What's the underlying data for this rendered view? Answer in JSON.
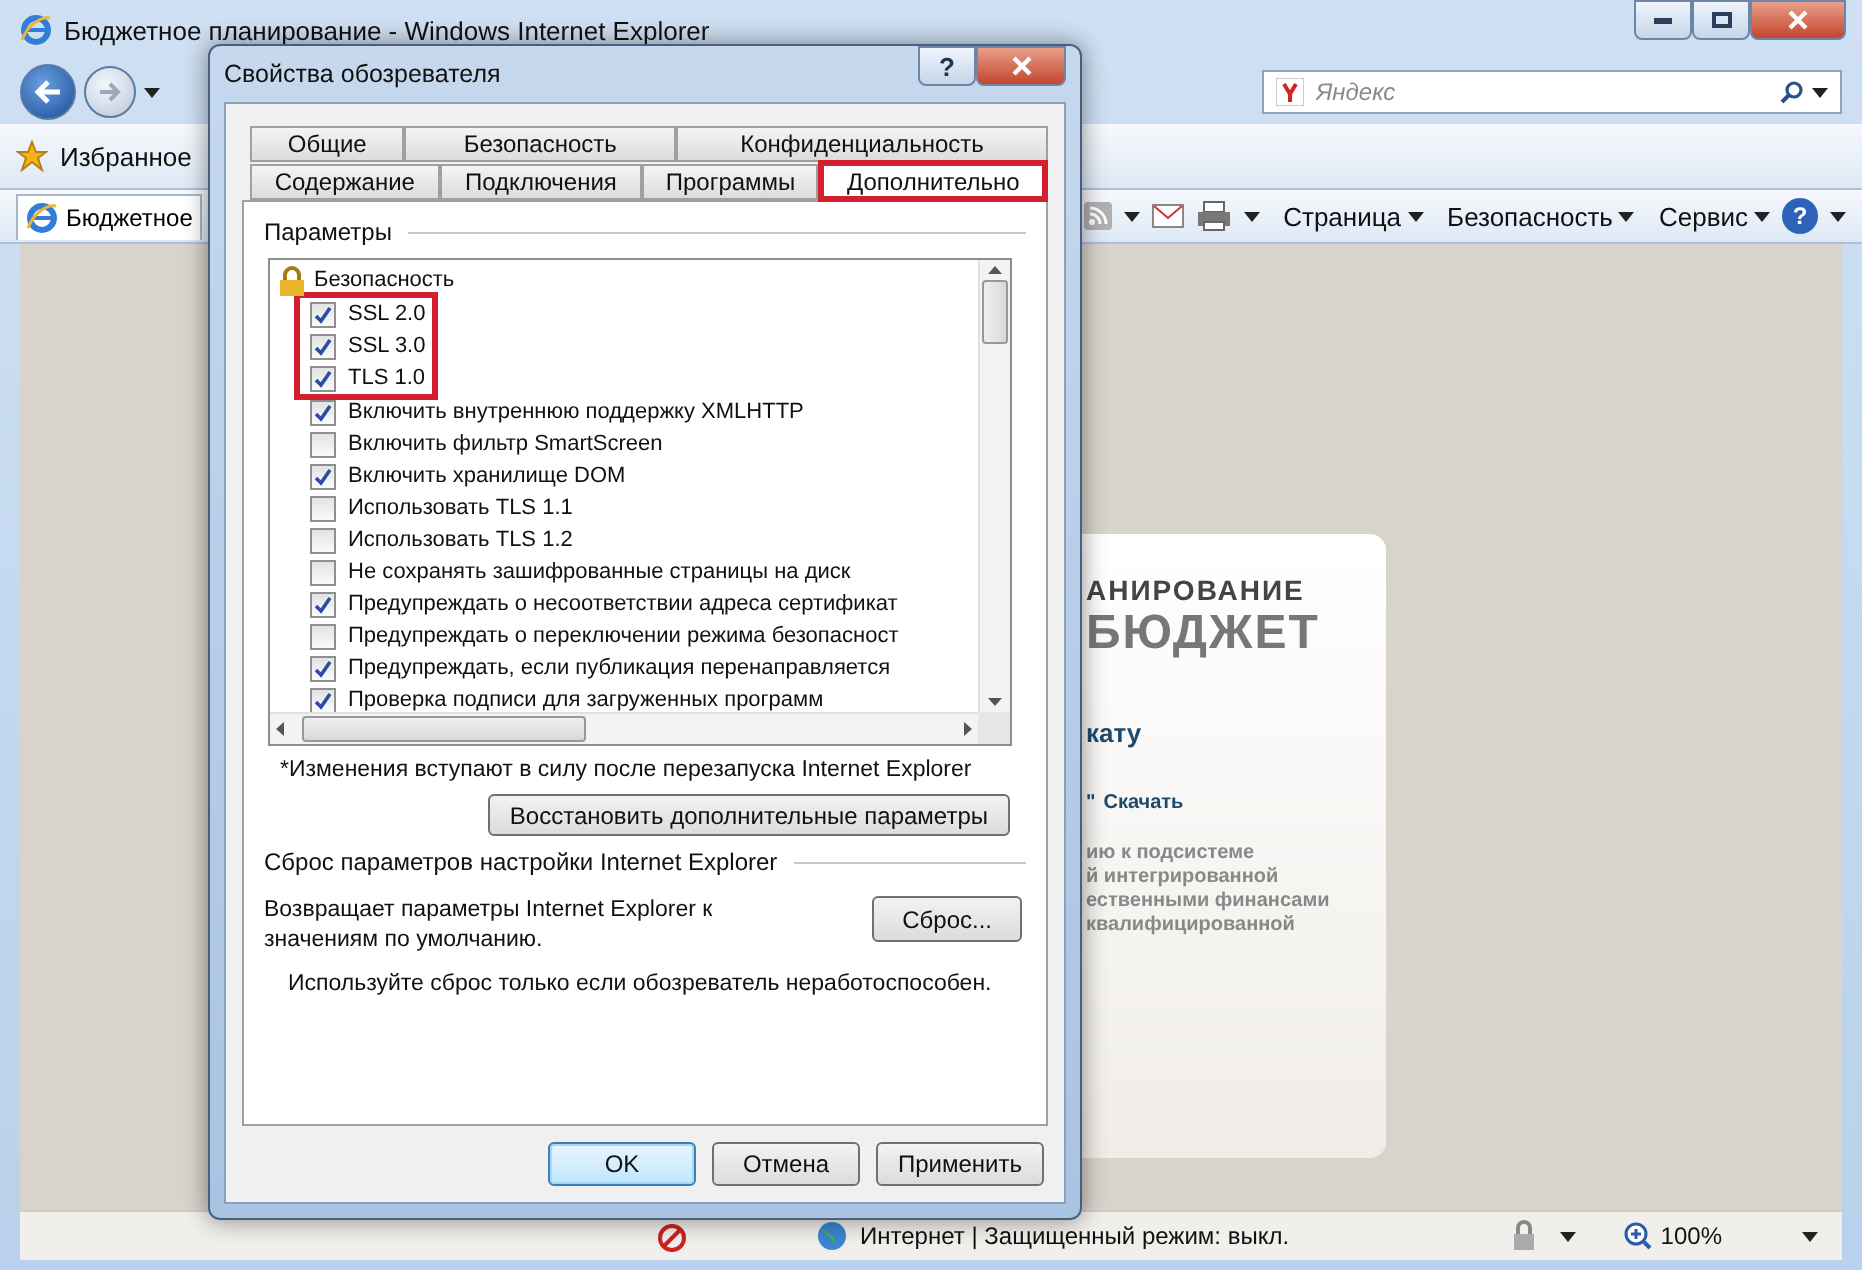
{
  "browser": {
    "title": "Бюджетное планирование - Windows Internet Explorer",
    "search": {
      "placeholder": "Яндекс"
    },
    "favorites": {
      "label": "Избранное"
    },
    "tab": {
      "label": "Бюджетное"
    },
    "commands": [
      "Страница",
      "Безопасность",
      "Сервис"
    ],
    "help_glyph": "?",
    "page": {
      "heading": "АНИРОВАНИЕ",
      "logo": "БЮДЖЕТ",
      "subheading": "кату",
      "download_prefix": "\"",
      "download_link": "Скачать",
      "description": [
        "ию к подсистеме",
        "й интегрированной",
        "ественными финансами",
        "квалифицированной"
      ]
    },
    "status_bar": {
      "zone": "Интернет | Защищенный режим: выкл.",
      "zoom": "100%"
    }
  },
  "dialog": {
    "title": "Свойства обозревателя",
    "help_glyph": "?",
    "tab_rows": [
      [
        {
          "label": "Общие",
          "selected": false,
          "highlighted": false
        },
        {
          "label": "Безопасность",
          "selected": false,
          "highlighted": false
        },
        {
          "label": "Конфиденциальность",
          "selected": false,
          "highlighted": false
        }
      ],
      [
        {
          "label": "Содержание",
          "selected": false,
          "highlighted": false
        },
        {
          "label": "Подключения",
          "selected": false,
          "highlighted": false
        },
        {
          "label": "Программы",
          "selected": false,
          "highlighted": false
        },
        {
          "label": "Дополнительно",
          "selected": true,
          "highlighted": true
        }
      ]
    ],
    "settings_group": "Параметры",
    "settings_tree": [
      {
        "label": "Безопасность",
        "children": [
          {
            "label": "SSL 2.0",
            "checked": true,
            "highlighted": true
          },
          {
            "label": "SSL 3.0",
            "checked": true,
            "highlighted": true
          },
          {
            "label": "TLS 1.0",
            "checked": true,
            "highlighted": true
          },
          {
            "label": "Включить внутреннюю поддержку XMLHTTP",
            "checked": true,
            "highlighted": false
          },
          {
            "label": "Включить фильтр SmartScreen",
            "checked": false,
            "highlighted": false
          },
          {
            "label": "Включить хранилище DOM",
            "checked": true,
            "highlighted": false
          },
          {
            "label": "Использовать TLS 1.1",
            "checked": false,
            "highlighted": false
          },
          {
            "label": "Использовать TLS 1.2",
            "checked": false,
            "highlighted": false
          },
          {
            "label": "Не сохранять зашифрованные страницы на диск",
            "checked": false,
            "highlighted": false
          },
          {
            "label": "Предупреждать о несоответствии адреса сертификат",
            "checked": true,
            "highlighted": false
          },
          {
            "label": "Предупреждать о переключении режима безопасност",
            "checked": false,
            "highlighted": false
          },
          {
            "label": "Предупреждать, если публикация перенаправляется",
            "checked": true,
            "highlighted": false
          },
          {
            "label": "Проверка подписи для загруженных программ",
            "checked": true,
            "highlighted": false
          }
        ]
      }
    ],
    "restart_note": "*Изменения вступают в силу после перезапуска Internet Explorer",
    "restore_button": "Восстановить дополнительные параметры",
    "reset_group": "Сброс параметров настройки Internet Explorer",
    "reset_description": "Возвращает параметры Internet Explorer к значениям по умолчанию.",
    "reset_button": "Сброс...",
    "reset_warning": "Используйте сброс только если обозреватель неработоспособен.",
    "buttons": [
      {
        "label": "OK",
        "kind": "default"
      },
      {
        "label": "Отмена",
        "kind": "normal"
      },
      {
        "label": "Применить",
        "kind": "normal"
      }
    ]
  }
}
